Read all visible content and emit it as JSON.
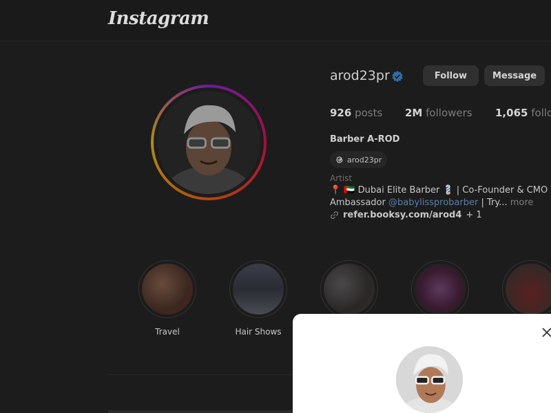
{
  "app": {
    "logo_text": "Instagram"
  },
  "profile": {
    "username": "arod23pr",
    "verified": true,
    "follow_label": "Follow",
    "message_label": "Message",
    "stats": {
      "posts_count": "926",
      "posts_label": "posts",
      "followers_count": "2M",
      "followers_label": "followers",
      "following_count": "1,065",
      "following_label": "following"
    },
    "full_name": "Barber A-ROD",
    "threads_handle": "arod23pr",
    "category": "Artist",
    "bio_line1": "📍 🇦🇪 Dubai Elite Barber 💈 | Co-Founder & CMO of",
    "bio_line2_prefix": "Ambassador",
    "bio_mention": "@babylissprobarber",
    "bio_line2_suffix": "| Try...",
    "more_label": "more",
    "link_text": "refer.booksy.com/arod4",
    "link_extra": "+ 1"
  },
  "highlights": [
    {
      "label": "Travel",
      "color": "#5a3a30"
    },
    {
      "label": "Hair Shows",
      "color": "#3a3d48"
    },
    {
      "label": "",
      "color": "#3a3838"
    },
    {
      "label": "",
      "color": "#4a2a40"
    },
    {
      "label": "",
      "color": "#4a2a28"
    }
  ],
  "colors": {
    "verified": "#2f6ca3",
    "background": "#1c1c1c",
    "modal": "#ffffff"
  },
  "icons": {
    "verified": "verified-badge-icon",
    "threads": "threads-icon",
    "link": "link-icon",
    "close": "close-icon"
  }
}
